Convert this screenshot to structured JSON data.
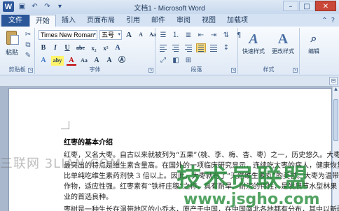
{
  "titlebar": {
    "title": "文档1 - Microsoft Word",
    "logo": "W",
    "qat": [
      "save-icon",
      "undo-icon",
      "redo-icon",
      "dropdown-icon"
    ],
    "controls": [
      "–",
      "□",
      "✕"
    ]
  },
  "tabs": {
    "file": "文件",
    "items": [
      "开始",
      "插入",
      "页面布局",
      "引用",
      "邮件",
      "审阅",
      "视图",
      "加载项"
    ],
    "active": "开始"
  },
  "ribbon": {
    "clipboard": {
      "label": "剪贴板",
      "paste": "粘贴"
    },
    "font": {
      "label": "字体",
      "font_name": "Times New Roman",
      "font_size": "五号",
      "buttons_row1": [
        "A",
        "A",
        "Aa",
        "A",
        "wén",
        "A"
      ],
      "buttons_row2": [
        "B",
        "I",
        "U",
        "abe",
        "x₂",
        "x²",
        "A"
      ],
      "buttons_row3": [
        "A",
        "aby",
        "A",
        "Aa",
        "A",
        "A",
        "Ⓐ"
      ]
    },
    "paragraph": {
      "label": "段落"
    },
    "styles": {
      "label": "样式",
      "quick": "快速样式",
      "change": "更改样式"
    },
    "editing": {
      "label": "编辑"
    }
  },
  "document": {
    "heading": "红枣的基本介绍",
    "lines": [
      "红枣，又名大枣。自古以来就被列为“五果”（桃、李、梅、杏、枣）之一，历史悠久。大枣",
      "最突出的特点是维生素含量高。在国外的一项临床研究显示，连续吃大枣的病人，健康恢复",
      "比单纯吃维生素药剂快 3 倍以上。因此，大枣就有了“天然维生素丸”的美誉。大枣为温带",
      "作物，适应性强。红枣素有“铁杆庄稼”之称，具有耐旱、耐涝的特性，是发展节水型林果",
      "业的首选良种。",
      "枣树是一种生长在温带地区的小乔木，原产于中国，在中国南北各地都有分布，其中以新疆"
    ]
  },
  "watermarks": {
    "left": "三联网 3LIAN.COM",
    "big": "技术员联盟",
    "url": "www.jsgho.com"
  }
}
